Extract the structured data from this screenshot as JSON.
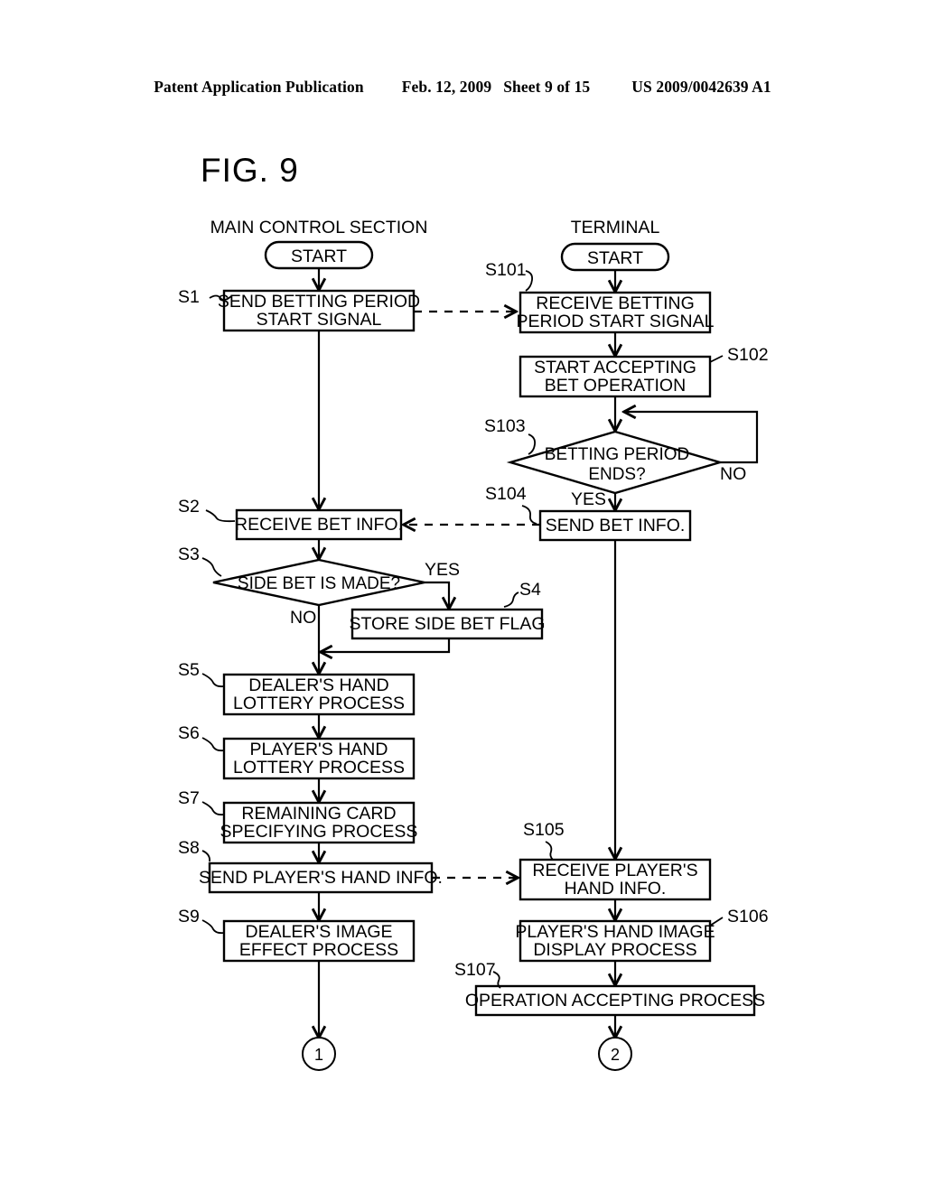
{
  "header": {
    "publication": "Patent Application Publication",
    "date": "Feb. 12, 2009",
    "sheet": "Sheet 9 of 15",
    "patent_number": "US 2009/0042639 A1"
  },
  "figure": {
    "title": "FIG. 9"
  },
  "columns": {
    "left_title": "MAIN CONTROL SECTION",
    "right_title": "TERMINAL"
  },
  "terminators": {
    "left_start": "START",
    "right_start": "START"
  },
  "left_column": {
    "nodes": [
      {
        "id": "S1",
        "step": "S1",
        "shape": "process",
        "lines": [
          "SEND BETTING PERIOD",
          "START SIGNAL"
        ]
      },
      {
        "id": "S2",
        "step": "S2",
        "shape": "process",
        "lines": [
          "RECEIVE BET INFO."
        ]
      },
      {
        "id": "S3",
        "step": "S3",
        "shape": "decision",
        "lines": [
          "SIDE BET IS MADE?"
        ],
        "branch_yes": "YES",
        "branch_no": "NO"
      },
      {
        "id": "S4",
        "step": "S4",
        "shape": "process",
        "lines": [
          "STORE SIDE BET FLAG"
        ]
      },
      {
        "id": "S5",
        "step": "S5",
        "shape": "process",
        "lines": [
          "DEALER'S HAND",
          "LOTTERY PROCESS"
        ]
      },
      {
        "id": "S6",
        "step": "S6",
        "shape": "process",
        "lines": [
          "PLAYER'S HAND",
          "LOTTERY PROCESS"
        ]
      },
      {
        "id": "S7",
        "step": "S7",
        "shape": "process",
        "lines": [
          "REMAINING CARD",
          "SPECIFYING PROCESS"
        ]
      },
      {
        "id": "S8",
        "step": "S8",
        "shape": "process",
        "lines": [
          "SEND PLAYER'S HAND INFO."
        ]
      },
      {
        "id": "S9",
        "step": "S9",
        "shape": "process",
        "lines": [
          "DEALER'S IMAGE",
          "EFFECT PROCESS"
        ]
      }
    ],
    "exit_connector": "1"
  },
  "right_column": {
    "nodes": [
      {
        "id": "S101",
        "step": "S101",
        "shape": "process",
        "lines": [
          "RECEIVE BETTING",
          "PERIOD START SIGNAL"
        ]
      },
      {
        "id": "S102",
        "step": "S102",
        "shape": "process",
        "lines": [
          "START ACCEPTING",
          "BET OPERATION"
        ]
      },
      {
        "id": "S103",
        "step": "S103",
        "shape": "decision",
        "lines": [
          "BETTING PERIOD",
          "ENDS?"
        ],
        "branch_yes": "YES",
        "branch_no": "NO"
      },
      {
        "id": "S104",
        "step": "S104",
        "shape": "process",
        "lines": [
          "SEND BET INFO."
        ]
      },
      {
        "id": "S105",
        "step": "S105",
        "shape": "process",
        "lines": [
          "RECEIVE PLAYER'S",
          "HAND INFO."
        ]
      },
      {
        "id": "S106",
        "step": "S106",
        "shape": "process",
        "lines": [
          "PLAYER'S HAND IMAGE",
          "DISPLAY PROCESS"
        ]
      },
      {
        "id": "S107",
        "step": "S107",
        "shape": "process",
        "lines": [
          "OPERATION ACCEPTING PROCESS"
        ]
      }
    ],
    "exit_connector": "2"
  },
  "colors": {
    "ink": "#000000",
    "paper": "#ffffff"
  }
}
